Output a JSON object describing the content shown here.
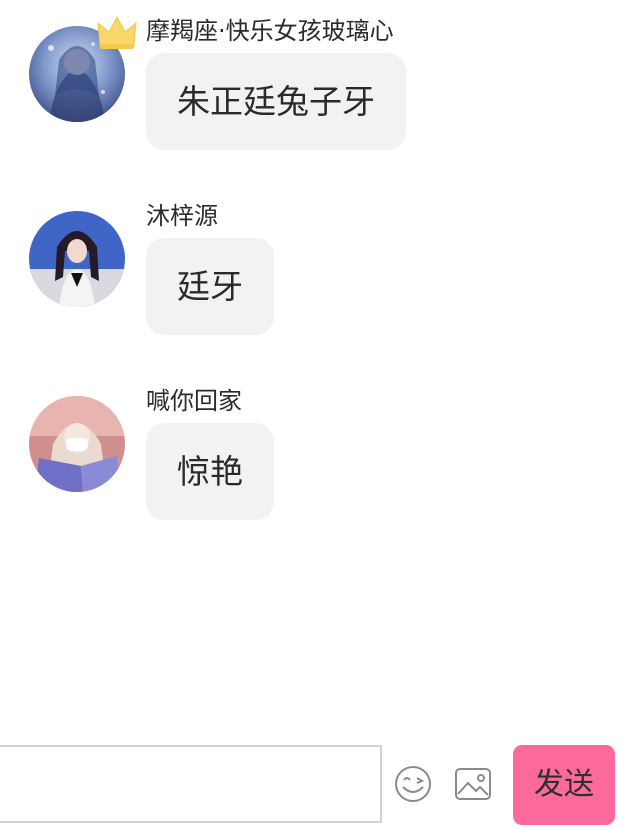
{
  "messages": [
    {
      "sender": "摩羯座·快乐女孩玻璃心",
      "text": "朱正廷兔子牙",
      "has_crown": true
    },
    {
      "sender": "沐梓源",
      "text": "廷牙",
      "has_crown": false
    },
    {
      "sender": "喊你回家",
      "text": "惊艳",
      "has_crown": false
    }
  ],
  "composer": {
    "input_value": "",
    "send_label": "发送",
    "emoji_icon": "smiley-icon",
    "image_icon": "image-icon",
    "send_color": "#fc6a9b"
  }
}
